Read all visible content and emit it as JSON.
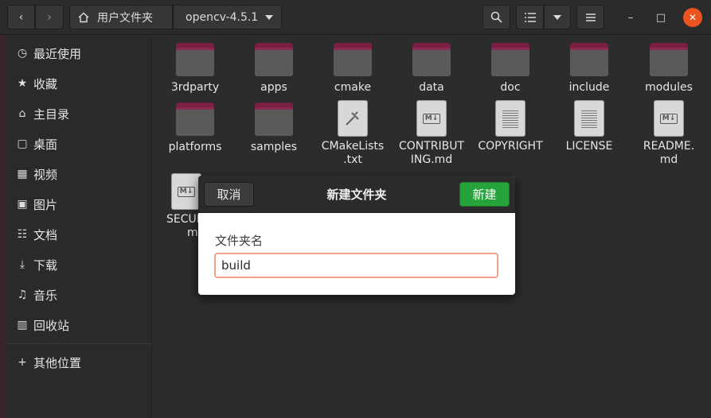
{
  "header": {
    "back_icon": "chevron-left-icon",
    "forward_icon": "chevron-right-icon",
    "path": [
      {
        "label": "用户文件夹",
        "icon": "home-icon"
      },
      {
        "label": "opencv-4.5.1",
        "icon": "caret-down-icon"
      }
    ],
    "search_icon": "search-icon",
    "view_list_icon": "list-view-icon",
    "view_options_icon": "caret-down-icon",
    "menu_icon": "hamburger-menu-icon",
    "window_controls": {
      "minimize": "–",
      "maximize": "□",
      "close": "✕"
    }
  },
  "sidebar": {
    "items": [
      {
        "label": "最近使用",
        "icon": "recent-icon"
      },
      {
        "label": "收藏",
        "icon": "star-icon"
      },
      {
        "label": "主目录",
        "icon": "home-icon"
      },
      {
        "label": "桌面",
        "icon": "desktop-icon"
      },
      {
        "label": "视频",
        "icon": "video-icon"
      },
      {
        "label": "图片",
        "icon": "pictures-icon"
      },
      {
        "label": "文档",
        "icon": "documents-icon"
      },
      {
        "label": "下载",
        "icon": "download-icon"
      },
      {
        "label": "音乐",
        "icon": "music-icon"
      },
      {
        "label": "回收站",
        "icon": "trash-icon"
      },
      {
        "label": "其他位置",
        "icon": "plus-icon"
      }
    ]
  },
  "files": [
    {
      "name": "3rdparty",
      "kind": "folder"
    },
    {
      "name": "apps",
      "kind": "folder"
    },
    {
      "name": "cmake",
      "kind": "folder"
    },
    {
      "name": "data",
      "kind": "folder"
    },
    {
      "name": "doc",
      "kind": "folder"
    },
    {
      "name": "include",
      "kind": "folder"
    },
    {
      "name": "modules",
      "kind": "folder"
    },
    {
      "name": "platforms",
      "kind": "folder"
    },
    {
      "name": "samples",
      "kind": "folder"
    },
    {
      "name_line1": "CMakeLists",
      "name_line2": ".txt",
      "kind": "cmake-file"
    },
    {
      "name_line1": "CONTRIBUT",
      "name_line2": "ING.md",
      "kind": "markdown-file"
    },
    {
      "name": "COPYRIGHT",
      "kind": "text-file"
    },
    {
      "name": "LICENSE",
      "kind": "text-file"
    },
    {
      "name_line1": "README.",
      "name_line2": "md",
      "kind": "markdown-file"
    },
    {
      "name_line1": "SECUR",
      "name_line2": "m",
      "kind": "markdown-file"
    }
  ],
  "dialog": {
    "cancel_label": "取消",
    "title": "新建文件夹",
    "create_label": "新建",
    "field_label": "文件夹名",
    "field_value": "build"
  }
}
